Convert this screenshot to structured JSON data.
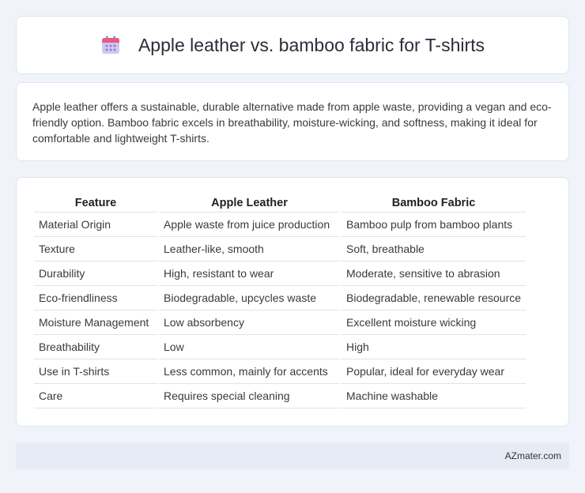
{
  "header": {
    "title": "Apple leather vs. bamboo fabric for T-shirts",
    "icon": "calendar-icon",
    "icon_colors": {
      "top": "#f0587a",
      "body": "#cfc8f0",
      "dots": "#8e83d8"
    }
  },
  "summary": {
    "text": "Apple leather offers a sustainable, durable alternative made from apple waste, providing a vegan and eco-friendly option. Bamboo fabric excels in breathability, moisture-wicking, and softness, making it ideal for comfortable and lightweight T-shirts."
  },
  "table": {
    "headers": [
      "Feature",
      "Apple Leather",
      "Bamboo Fabric"
    ],
    "rows": [
      [
        "Material Origin",
        "Apple waste from juice production",
        "Bamboo pulp from bamboo plants"
      ],
      [
        "Texture",
        "Leather-like, smooth",
        "Soft, breathable"
      ],
      [
        "Durability",
        "High, resistant to wear",
        "Moderate, sensitive to abrasion"
      ],
      [
        "Eco-friendliness",
        "Biodegradable, upcycles waste",
        "Biodegradable, renewable resource"
      ],
      [
        "Moisture Management",
        "Low absorbency",
        "Excellent moisture wicking"
      ],
      [
        "Breathability",
        "Low",
        "High"
      ],
      [
        "Use in T-shirts",
        "Less common, mainly for accents",
        "Popular, ideal for everyday wear"
      ],
      [
        "Care",
        "Requires special cleaning",
        "Machine washable"
      ]
    ]
  },
  "footer": {
    "text": "AZmater.com"
  }
}
